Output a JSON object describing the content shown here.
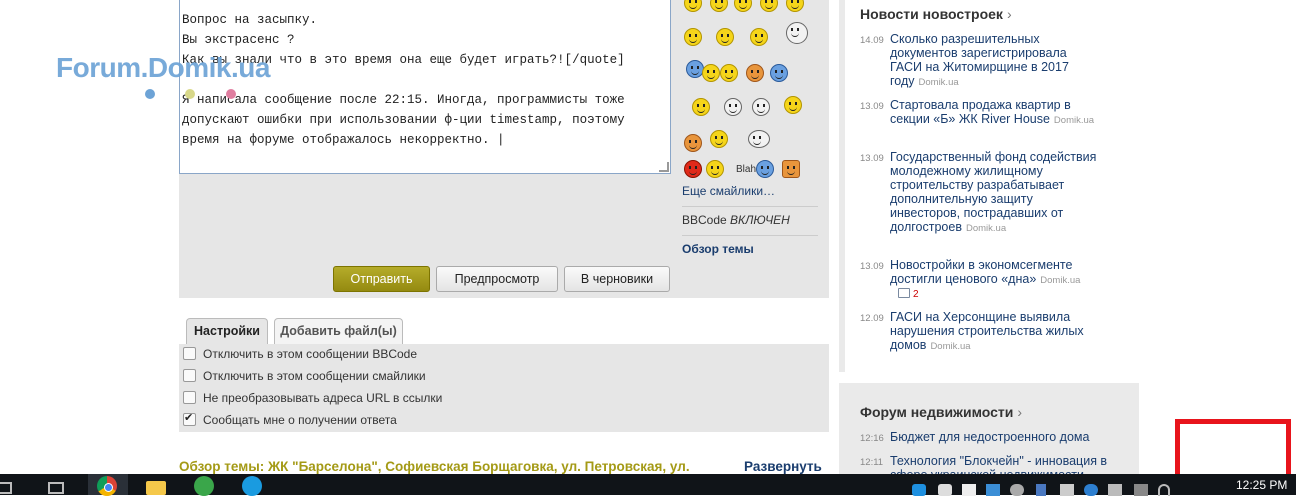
{
  "editor": {
    "lines": [
      "Вопрос на засыпку.",
      "Вы экстрасенс ?",
      "Как вы знали что в это время она еще будет играть?![/quote]",
      "",
      "Я написала сообщение после 22:15. Иногда, программисты тоже",
      "допускают ошибки при использовании ф-ции timestamp, поэтому",
      "время на форуме отображалось некорректно. |"
    ]
  },
  "logo": {
    "text": "Forum.Domik.ua"
  },
  "smilies_panel": {
    "more_label": "Еще смайлики…",
    "bbcode_label": "BBCode",
    "bbcode_state": "ВКЛЮЧЕН",
    "topic_review_label": "Обзор темы",
    "blah_label": "Blah"
  },
  "buttons": {
    "send": "Отправить",
    "preview": "Предпросмотр",
    "draft": "В черновики"
  },
  "tabs": {
    "settings": "Настройки",
    "attach": "Добавить файл(ы)"
  },
  "options": [
    {
      "label": "Отключить в этом сообщении BBCode",
      "checked": false
    },
    {
      "label": "Отключить в этом сообщении смайлики",
      "checked": false
    },
    {
      "label": "Не преобразовывать адреса URL в ссылки",
      "checked": false
    },
    {
      "label": "Сообщать мне о получении ответа",
      "checked": true
    }
  ],
  "topic": {
    "title": "Обзор темы: ЖК \"Барселона\", Софиевская Борщаговка, ул. Петровская, ул.",
    "expand": "Развернуть"
  },
  "news": {
    "title": "Новости новостроек",
    "items": [
      {
        "date": "14.09",
        "text": "Сколько разрешительных документов зарегистрировала ГАСИ на Житомирщине в 2017 году",
        "source": "Domik.ua"
      },
      {
        "date": "13.09",
        "text": "Стартовала продажа квартир в секции «Б» ЖК River House",
        "source": "Domik.ua"
      },
      {
        "date": "13.09",
        "text": "Государственный фонд содействия молодежному жилищному строительству разрабатывает дополнительную защиту инвесторов, пострадавших от долгостроев",
        "source": "Domik.ua"
      },
      {
        "date": "13.09",
        "text": "Новостройки в экономсегменте достигли ценового «дна»",
        "source": "Domik.ua",
        "comments": "2"
      },
      {
        "date": "12.09",
        "text": "ГАСИ на Херсонщине выявила нарушения строительства жилых домов",
        "source": "Domik.ua"
      }
    ]
  },
  "forum": {
    "title": "Форум недвижимости",
    "items": [
      {
        "time": "12:16",
        "text": "Бюджет для недостроенного дома"
      },
      {
        "time": "12:11",
        "text": "Технология \"Блокчейн\" - инновация в сфере украинской недвижимости"
      }
    ]
  },
  "taskbar": {
    "clock": "12:25 PM"
  },
  "colors": {
    "accent_olive": "#a49a16",
    "link_blue": "#1a3d6e",
    "highlight_red": "#e8141c"
  }
}
